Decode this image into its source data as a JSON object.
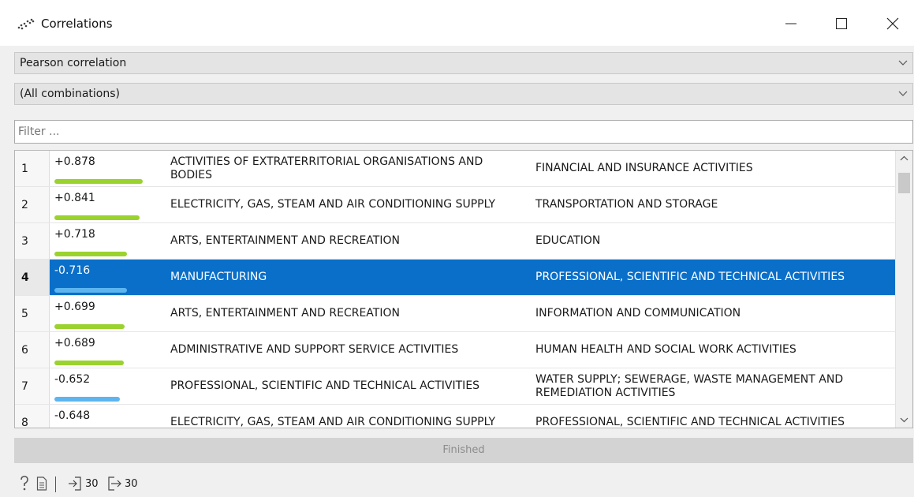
{
  "window": {
    "title": "Correlations",
    "icon": "scatter-dots-icon",
    "controls": [
      "minimize-icon",
      "maximize-icon",
      "close-icon"
    ]
  },
  "method_select": {
    "value": "Pearson correlation"
  },
  "feature_select": {
    "value": "(All combinations)"
  },
  "filter": {
    "placeholder": "Filter ..."
  },
  "colors": {
    "positive_bar": "#9ad22e",
    "negative_bar": "#5db5f0",
    "selection": "#0a6fc9"
  },
  "rows": [
    {
      "index": "1",
      "value": "+0.878",
      "magnitude": 0.878,
      "sign": "positive",
      "feature_a": "ACTIVITIES OF EXTRATERRITORIAL ORGANISATIONS AND BODIES",
      "feature_b": "FINANCIAL AND INSURANCE ACTIVITIES"
    },
    {
      "index": "2",
      "value": "+0.841",
      "magnitude": 0.841,
      "sign": "positive",
      "feature_a": "ELECTRICITY, GAS, STEAM AND AIR CONDITIONING SUPPLY",
      "feature_b": "TRANSPORTATION AND STORAGE"
    },
    {
      "index": "3",
      "value": "+0.718",
      "magnitude": 0.718,
      "sign": "positive",
      "feature_a": "ARTS, ENTERTAINMENT AND RECREATION",
      "feature_b": "EDUCATION"
    },
    {
      "index": "4",
      "value": "-0.716",
      "magnitude": 0.716,
      "sign": "negative",
      "selected": true,
      "feature_a": "MANUFACTURING",
      "feature_b": "PROFESSIONAL, SCIENTIFIC AND TECHNICAL ACTIVITIES"
    },
    {
      "index": "5",
      "value": "+0.699",
      "magnitude": 0.699,
      "sign": "positive",
      "feature_a": "ARTS, ENTERTAINMENT AND RECREATION",
      "feature_b": "INFORMATION AND COMMUNICATION"
    },
    {
      "index": "6",
      "value": "+0.689",
      "magnitude": 0.689,
      "sign": "positive",
      "feature_a": "ADMINISTRATIVE AND SUPPORT SERVICE ACTIVITIES",
      "feature_b": "HUMAN HEALTH AND SOCIAL WORK ACTIVITIES"
    },
    {
      "index": "7",
      "value": "-0.652",
      "magnitude": 0.652,
      "sign": "negative",
      "feature_a": "PROFESSIONAL, SCIENTIFIC AND TECHNICAL ACTIVITIES",
      "feature_b": "WATER SUPPLY; SEWERAGE, WASTE MANAGEMENT AND REMEDIATION ACTIVITIES"
    },
    {
      "index": "8",
      "value": "-0.648",
      "magnitude": 0.648,
      "sign": "negative",
      "feature_a": "ELECTRICITY, GAS, STEAM AND AIR CONDITIONING SUPPLY",
      "feature_b": "PROFESSIONAL, SCIENTIFIC AND TECHNICAL ACTIVITIES"
    }
  ],
  "status": {
    "text": "Finished"
  },
  "footer": {
    "help_icon": "help-icon",
    "report_icon": "report-icon",
    "input_count": "30",
    "output_count": "30"
  }
}
